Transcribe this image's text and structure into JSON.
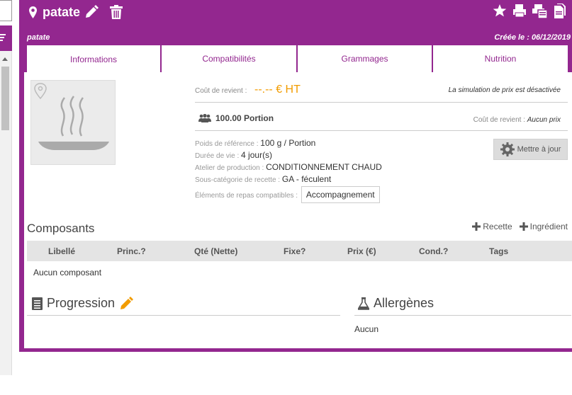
{
  "header": {
    "title": "patate",
    "subtitle": "patate",
    "created": "Créée le : 06/12/2019"
  },
  "tabs": [
    {
      "label": "Informations",
      "active": true
    },
    {
      "label": "Compatibilités",
      "active": false
    },
    {
      "label": "Grammages",
      "active": false
    },
    {
      "label": "Nutrition",
      "active": false
    }
  ],
  "info": {
    "cost_label": "Coût de revient :",
    "cost_value": "--.--  € HT",
    "simulation_note": "La simulation de prix est désactivée",
    "portion": "100.00 Portion",
    "cost2_label": "Coût de revient :",
    "cost2_value": "Aucun prix",
    "weight_label": "Poids de référence :",
    "weight_value": "100 g / Portion",
    "life_label": "Durée de vie :",
    "life_value": "4 jour(s)",
    "workshop_label": "Atelier de production :",
    "workshop_value": "CONDITIONNEMENT CHAUD",
    "subcat_label": "Sous-catégorie de recette :",
    "subcat_value": "GA - féculent",
    "compat_label": "Éléments de repas compatibles :",
    "compat_value": "Accompagnement",
    "update_button": "Mettre à jour"
  },
  "composants": {
    "title": "Composants",
    "add_recipe": "Recette",
    "add_ingredient": "Ingrédient",
    "columns": [
      "Libellé",
      "Princ.?",
      "Qté (Nette)",
      "Fixe?",
      "Prix (€)",
      "Cond.?",
      "Tags"
    ],
    "empty": "Aucun composant"
  },
  "progression": {
    "title": "Progression"
  },
  "allergenes": {
    "title": "Allergènes",
    "value": "Aucun"
  },
  "colors": {
    "brand": "#93278f",
    "accent": "#f29c00",
    "header_bg": "#e4e4e4"
  }
}
